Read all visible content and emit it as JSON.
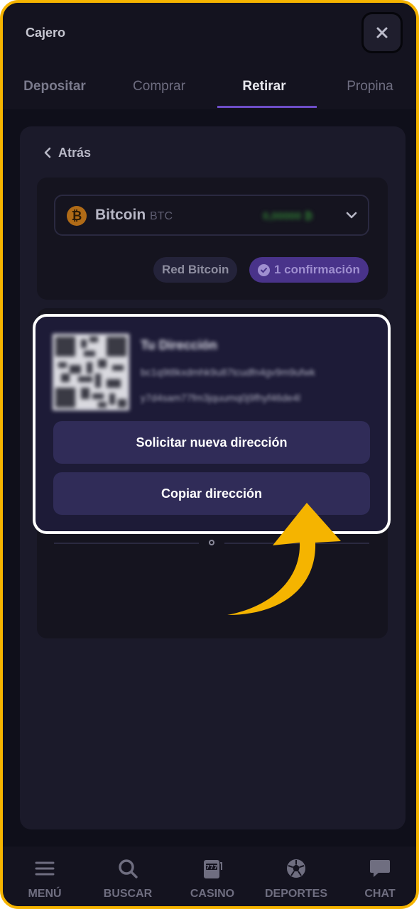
{
  "header": {
    "title": "Cajero",
    "close_icon": "close-icon"
  },
  "tabs": [
    {
      "label": "Depositar"
    },
    {
      "label": "Comprar"
    },
    {
      "label": "Retirar",
      "active": true
    },
    {
      "label": "Propina"
    }
  ],
  "back": {
    "label": "Atrás"
  },
  "coin": {
    "name": "Bitcoin",
    "ticker": "BTC",
    "balance": "0,00000 ₿",
    "icon": "bitcoin-icon"
  },
  "network": {
    "label": "Red Bitcoin"
  },
  "confirmations": {
    "label": "1 confirmación"
  },
  "address": {
    "title": "Tu Dirección",
    "line1": "bc1q9t8kxdmhk9u87tcudfn4gv9m9ufwk",
    "line2": "y7d4sam77fm3jquumq0j9fhyf46de4l"
  },
  "buttons": {
    "request_new": "Solicitar nueva dirección",
    "copy": "Copiar dirección"
  },
  "bottom_nav": [
    {
      "label": "MENÚ",
      "icon": "menu-icon"
    },
    {
      "label": "BUSCAR",
      "icon": "search-icon"
    },
    {
      "label": "CASINO",
      "icon": "slot-machine-icon"
    },
    {
      "label": "DEPORTES",
      "icon": "soccer-ball-icon"
    },
    {
      "label": "CHAT",
      "icon": "chat-bubble-icon"
    }
  ],
  "colors": {
    "frame_border": "#F5B400",
    "accent_purple": "#6d4dc8",
    "arrow": "#F5B400",
    "highlight_border": "#ffffff"
  }
}
